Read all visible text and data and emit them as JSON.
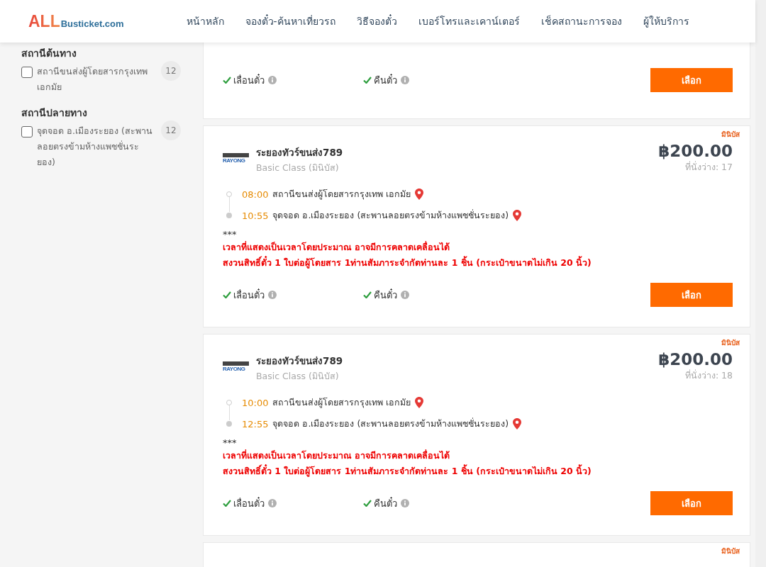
{
  "header": {
    "logo": {
      "accent": "ALL",
      "rest": "Busticket.com"
    },
    "nav": [
      {
        "label": "หน้าหลัก"
      },
      {
        "label": "จองตั๋ว-ค้นหาเที่ยวรถ"
      },
      {
        "label": "วิธีจองตั๋ว"
      },
      {
        "label": "เบอร์โทรและเคาน์เตอร์"
      },
      {
        "label": "เช็คสถานะการจอง"
      },
      {
        "label": "ผู้ให้บริการ"
      }
    ]
  },
  "sidebar": {
    "sections": [
      {
        "title": "สถานีต้นทาง",
        "options": [
          {
            "label": "สถานีขนส่งผู้โดยสารกรุงเทพ เอกมัย",
            "count": "12",
            "checked": false
          }
        ]
      },
      {
        "title": "สถานีปลายทาง",
        "options": [
          {
            "label": "จุดจอด อ.เมืองระยอง (สะพานลอยตรงข้ามห้างแพชชั่นระยอง)",
            "count": "12",
            "checked": false
          }
        ]
      }
    ]
  },
  "trips": [
    {
      "features": [
        "เลื่อนตั๋ว",
        "คืนตั๋ว"
      ],
      "button": "เลือก"
    },
    {
      "badge": "มินิบัส",
      "logo_text": "RAYONG",
      "operator": "ระยองทัวร์ขนส่ง789",
      "class": "Basic Class (มินิบัส)",
      "price": "฿200.00",
      "seats": "ที่นั่งว่าง: 17",
      "stops": [
        {
          "time": "08:00",
          "place": "สถานีขนส่งผู้โดยสารกรุงเทพ เอกมัย",
          "kind": "departure"
        },
        {
          "time": "10:55",
          "place": "จุดจอด อ.เมืองระยอง (สะพานลอยตรงข้ามห้างแพชชั่นระยอง)",
          "kind": "arrival"
        }
      ],
      "note_mark": "***",
      "notes": [
        "เวลาที่แสดงเป็นเวลาโดยประมาณ อาจมีการคลาดเคลื่อนได้",
        "สงวนสิทธิ์ตั๋ว 1 ใบต่อผู้โดยสาร 1ท่านสัมภาระจำกัดท่านละ 1 ชิ้น (กระเป๋าขนาดไม่เกิน 20 นิ้ว)"
      ],
      "features": [
        "เลื่อนตั๋ว",
        "คืนตั๋ว"
      ],
      "button": "เลือก"
    },
    {
      "badge": "มินิบัส",
      "logo_text": "RAYONG",
      "operator": "ระยองทัวร์ขนส่ง789",
      "class": "Basic Class (มินิบัส)",
      "price": "฿200.00",
      "seats": "ที่นั่งว่าง: 18",
      "stops": [
        {
          "time": "10:00",
          "place": "สถานีขนส่งผู้โดยสารกรุงเทพ เอกมัย",
          "kind": "departure"
        },
        {
          "time": "12:55",
          "place": "จุดจอด อ.เมืองระยอง (สะพานลอยตรงข้ามห้างแพชชั่นระยอง)",
          "kind": "arrival"
        }
      ],
      "note_mark": "***",
      "notes": [
        "เวลาที่แสดงเป็นเวลาโดยประมาณ อาจมีการคลาดเคลื่อนได้",
        "สงวนสิทธิ์ตั๋ว 1 ใบต่อผู้โดยสาร 1ท่านสัมภาระจำกัดท่านละ 1 ชิ้น (กระเป๋าขนาดไม่เกิน 20 นิ้ว)"
      ],
      "features": [
        "เลื่อนตั๋ว",
        "คืนตั๋ว"
      ],
      "button": "เลือก"
    },
    {
      "badge": "มินิบัส"
    }
  ]
}
